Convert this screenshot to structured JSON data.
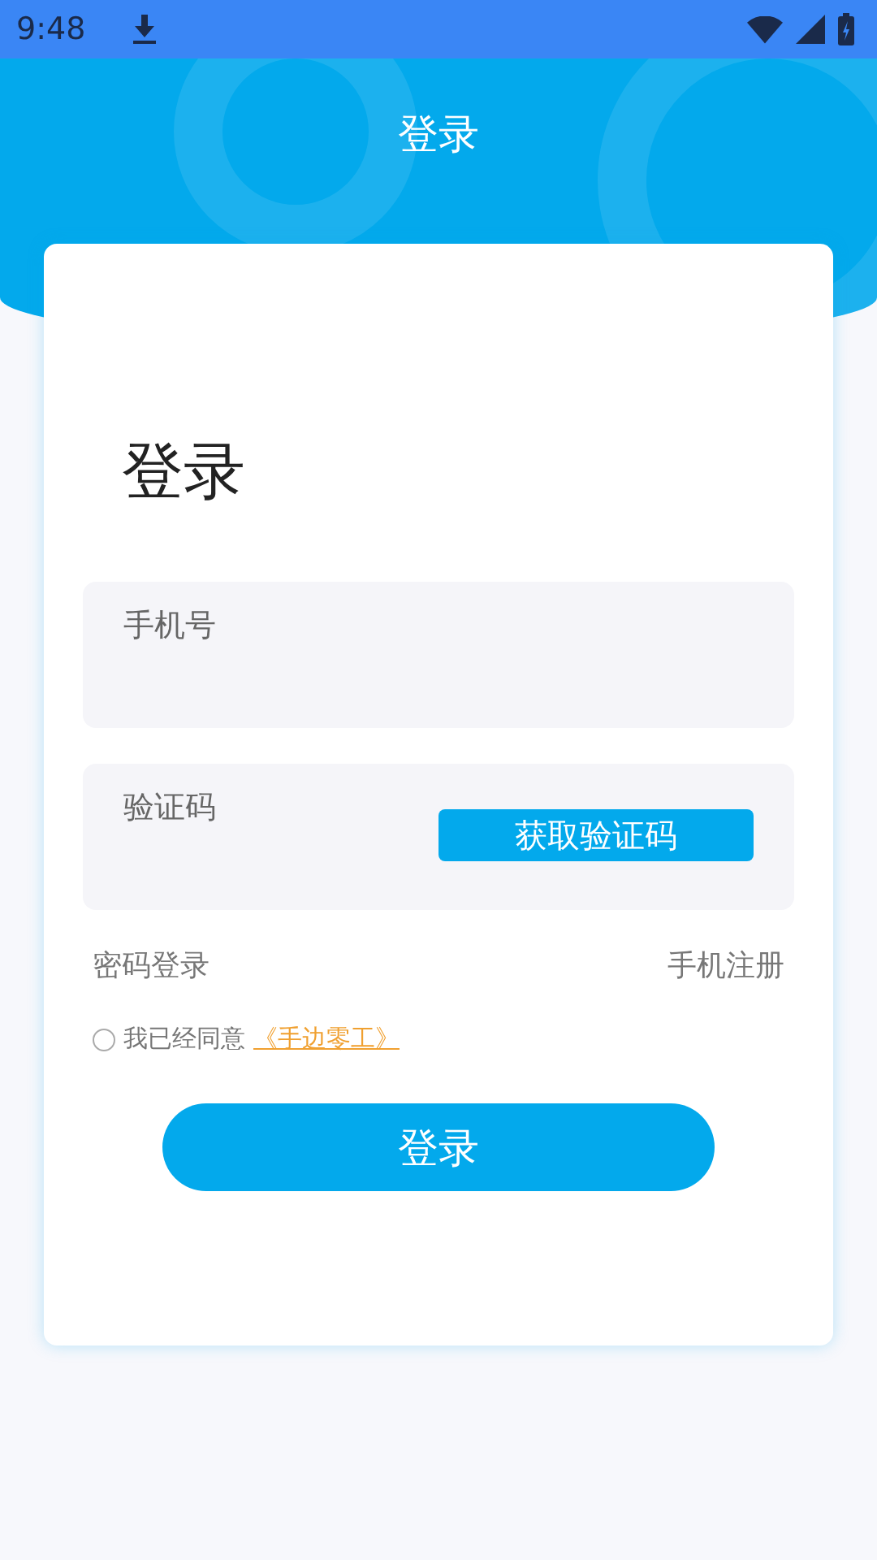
{
  "status_bar": {
    "time": "9:48"
  },
  "header": {
    "title": "登录"
  },
  "form": {
    "heading": "登录",
    "phone_field": {
      "placeholder": "手机号"
    },
    "code_field": {
      "placeholder": "验证码"
    },
    "get_code_button": "获取验证码",
    "links": [
      "密码登录",
      "手机注册"
    ],
    "agreement": {
      "checked": false,
      "text": "我已经同意",
      "link": "《手边零工》"
    },
    "login_button": "登录"
  }
}
